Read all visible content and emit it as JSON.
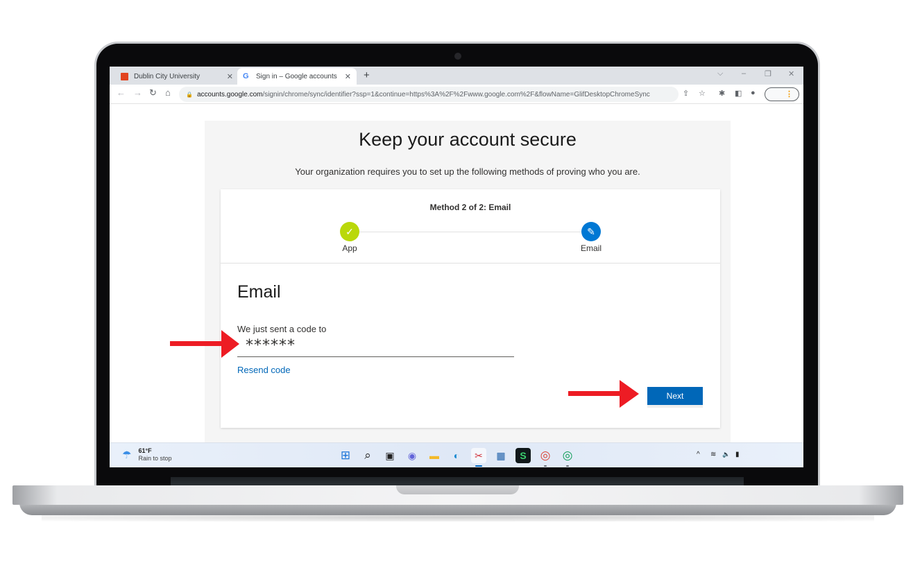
{
  "browser": {
    "tabs": [
      {
        "title": "Dublin City University",
        "favicon": "dcu-logo-icon",
        "active": false
      },
      {
        "title": "Sign in – Google accounts",
        "favicon": "google-g-icon",
        "active": true
      }
    ],
    "close_glyph": "✕",
    "new_tab_glyph": "+",
    "window_controls": {
      "dropdown": "⌵",
      "minimize": "–",
      "restore": "❐",
      "close": "✕"
    },
    "nav": {
      "back": "←",
      "forward": "→",
      "reload": "↻",
      "home": "⌂"
    },
    "address": {
      "host": "accounts.google.com",
      "path": "/signin/chrome/sync/identifier?ssp=1&continue=https%3A%2F%2Fwww.google.com%2F&flowName=GlifDesktopChromeSync"
    },
    "toolbar_icons": {
      "share": "⇪",
      "bookmark": "☆",
      "extensions": "✱",
      "sidepanel": "◧",
      "profile": "●",
      "menu": "⋮"
    }
  },
  "page": {
    "title": "Keep your account secure",
    "subtitle": "Your organization requires you to set up the following methods of proving who you are.",
    "method_title": "Method 2 of 2: Email",
    "steps": [
      {
        "label": "App",
        "status": "completed",
        "glyph": "✓"
      },
      {
        "label": "Email",
        "status": "current",
        "glyph": "✎"
      }
    ],
    "section_title": "Email",
    "sent_label": "We just sent a code to",
    "code_value": "******",
    "resend_link": "Resend code",
    "next_button": "Next",
    "colors": {
      "accent": "#0067b8",
      "step_done": "#bad80a",
      "step_current": "#0078d4",
      "annotation_arrow": "#ed1c24"
    }
  },
  "taskbar": {
    "weather": {
      "temp": "61°F",
      "desc": "Rain to stop"
    },
    "apps": [
      {
        "name": "start",
        "glyph": "⊞"
      },
      {
        "name": "search",
        "glyph": "⌕"
      },
      {
        "name": "task-view",
        "glyph": "▣"
      },
      {
        "name": "teams-chat",
        "glyph": "◉"
      },
      {
        "name": "file-explorer",
        "glyph": "▬"
      },
      {
        "name": "edge",
        "glyph": "◐"
      },
      {
        "name": "snipping-tool",
        "glyph": "✂"
      },
      {
        "name": "microsoft-store",
        "glyph": "▦"
      },
      {
        "name": "app-s",
        "glyph": "S"
      },
      {
        "name": "chrome-profile-1",
        "glyph": "◎"
      },
      {
        "name": "chrome-profile-2",
        "glyph": "◎"
      }
    ],
    "tray": {
      "chevron": "^",
      "wifi": "≋",
      "volume": "🔈",
      "battery": "▮"
    }
  }
}
